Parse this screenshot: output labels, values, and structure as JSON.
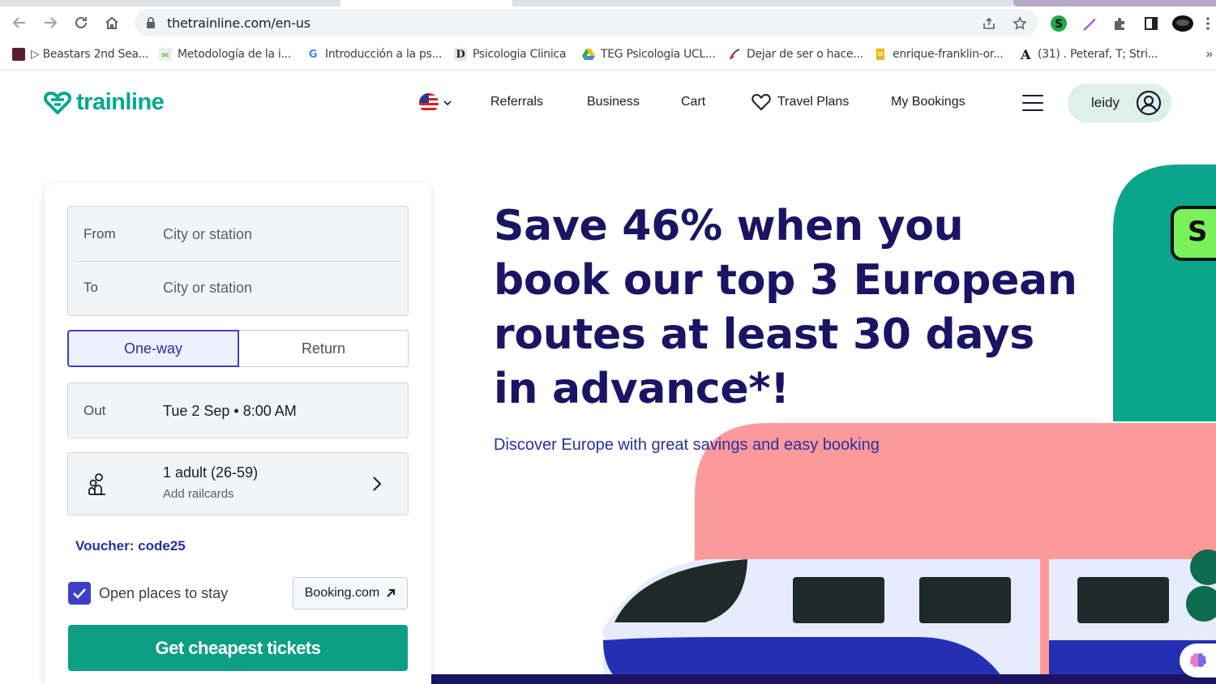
{
  "browser": {
    "url": "thetrainline.com/en-us",
    "bookmarks": [
      {
        "label": "▷ Beastars 2nd Sea...",
        "icon": "beastars-icon"
      },
      {
        "label": "Metodología de la i...",
        "icon": "scielo-icon"
      },
      {
        "label": "Introducción a la ps...",
        "icon": "google-icon"
      },
      {
        "label": "Psicologia Clinica",
        "icon": "d-icon"
      },
      {
        "label": "TEG Psicologia UCL...",
        "icon": "google-drive-icon"
      },
      {
        "label": "Dejar de ser o hace...",
        "icon": "pen-icon"
      },
      {
        "label": "enrique-franklin-or...",
        "icon": "docs-icon"
      },
      {
        "label": "(31) . Peteraf, T; Stri...",
        "icon": "a-icon"
      }
    ],
    "bookmarks_more": "»"
  },
  "site": {
    "logo_text": "trainline",
    "nav": {
      "referrals": "Referrals",
      "business": "Business",
      "cart": "Cart",
      "travel_plans": "Travel Plans",
      "my_bookings": "My Bookings",
      "user": "leidy"
    }
  },
  "search": {
    "from_label": "From",
    "from_placeholder": "City or station",
    "to_label": "To",
    "to_placeholder": "City or station",
    "trip_options": [
      "One-way",
      "Return"
    ],
    "selected_trip": "One-way",
    "out_label": "Out",
    "out_value": "Tue 2 Sep • 8:00 AM",
    "passengers": "1 adult (26-59)",
    "railcards": "Add railcards",
    "voucher": "Voucher: code25",
    "stay_label": "Open places to stay",
    "stay_checked": true,
    "booking_link": "Booking.com",
    "cta": "Get cheapest tickets"
  },
  "hero": {
    "title": "Save 46% when you book our top 3 European routes at least 30 days in advance*!",
    "subtitle": "Discover Europe with great savings and easy booking",
    "badge": "S"
  },
  "colors": {
    "brand": "#00a88f",
    "navy": "#1b1464",
    "accent": "#3e3fc9",
    "cta": "#0c9f85",
    "pink": "#fc9a9a"
  }
}
